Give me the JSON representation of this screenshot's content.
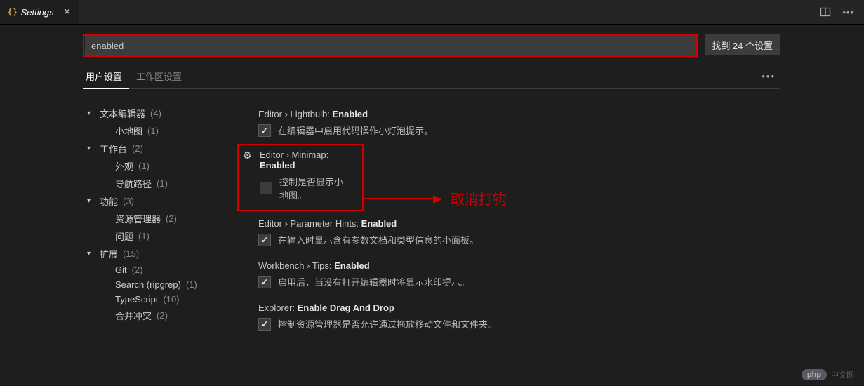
{
  "tab": {
    "icon": "{ }",
    "title": "Settings"
  },
  "search": {
    "value": "enabled"
  },
  "result_badge": "找到 24 个设置",
  "subtabs": {
    "user": "用户设置",
    "workspace": "工作区设置"
  },
  "outline": [
    {
      "label": "文本编辑器",
      "count": "(4)",
      "depth": 0,
      "caret": true
    },
    {
      "label": "小地图",
      "count": "(1)",
      "depth": 1,
      "caret": false
    },
    {
      "label": "工作台",
      "count": "(2)",
      "depth": 0,
      "caret": true
    },
    {
      "label": "外观",
      "count": "(1)",
      "depth": 1,
      "caret": false
    },
    {
      "label": "导航路径",
      "count": "(1)",
      "depth": 1,
      "caret": false
    },
    {
      "label": "功能",
      "count": "(3)",
      "depth": 0,
      "caret": true
    },
    {
      "label": "资源管理器",
      "count": "(2)",
      "depth": 1,
      "caret": false
    },
    {
      "label": "问题",
      "count": "(1)",
      "depth": 1,
      "caret": false
    },
    {
      "label": "扩展",
      "count": "(15)",
      "depth": 0,
      "caret": true
    },
    {
      "label": "Git",
      "count": "(2)",
      "depth": 1,
      "caret": false
    },
    {
      "label": "Search (ripgrep)",
      "count": "(1)",
      "depth": 1,
      "caret": false
    },
    {
      "label": "TypeScript",
      "count": "(10)",
      "depth": 1,
      "caret": false
    },
    {
      "label": "合并冲突",
      "count": "(2)",
      "depth": 1,
      "caret": false
    }
  ],
  "settings": [
    {
      "title_pre": "Editor › Lightbulb: ",
      "title_bold": "Enabled",
      "checked": true,
      "desc": "在编辑器中启用代码操作小灯泡提示。",
      "gear": false,
      "highlight": false
    },
    {
      "title_pre": "Editor › Minimap: ",
      "title_bold": "Enabled",
      "checked": false,
      "desc": "控制是否显示小地图。",
      "gear": true,
      "highlight": true
    },
    {
      "title_pre": "Editor › Parameter Hints: ",
      "title_bold": "Enabled",
      "checked": true,
      "desc": "在输入时显示含有参数文档和类型信息的小面板。",
      "gear": false,
      "highlight": false
    },
    {
      "title_pre": "Workbench › Tips: ",
      "title_bold": "Enabled",
      "checked": true,
      "desc": "启用后，当没有打开编辑器时将显示水印提示。",
      "gear": false,
      "highlight": false
    },
    {
      "title_pre": "Explorer: ",
      "title_bold": "Enable Drag And Drop",
      "checked": true,
      "desc": "控制资源管理器是否允许通过拖放移动文件和文件夹。",
      "gear": false,
      "highlight": false
    }
  ],
  "annotation": "取消打钩",
  "watermark": {
    "badge": "php",
    "text": "中文网"
  }
}
